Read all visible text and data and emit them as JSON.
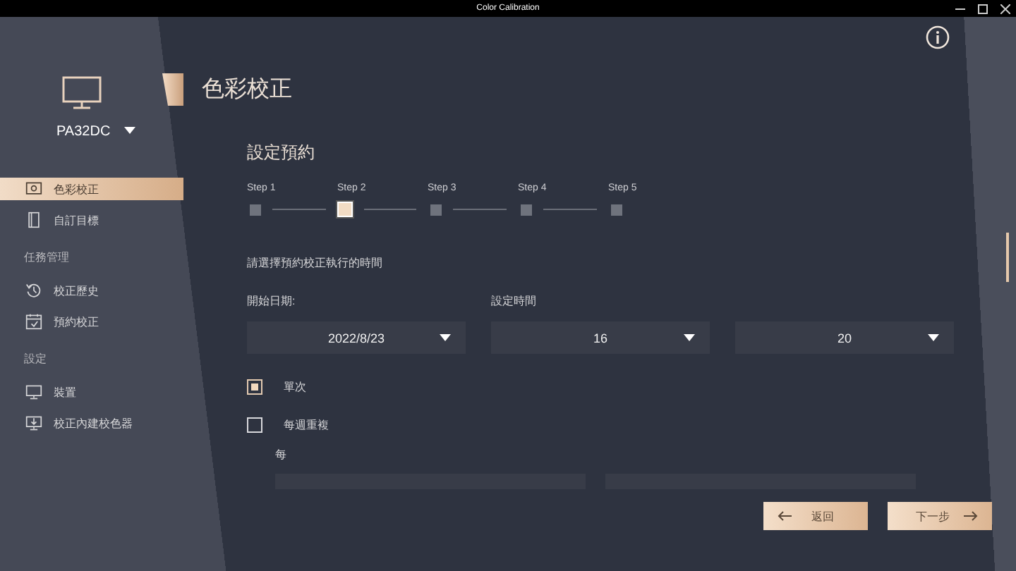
{
  "window": {
    "title": "Color Calibration"
  },
  "sidebar": {
    "device": "PA32DC",
    "sections": [
      {
        "items": [
          {
            "label": "色彩校正",
            "selected": true
          },
          {
            "label": "自訂目標",
            "selected": false
          }
        ]
      },
      {
        "heading": "任務管理",
        "items": [
          {
            "label": "校正歷史",
            "selected": false
          },
          {
            "label": "預約校正",
            "selected": false
          }
        ]
      },
      {
        "heading": "設定",
        "items": [
          {
            "label": "裝置",
            "selected": false
          },
          {
            "label": "校正內建校色器",
            "selected": false
          }
        ]
      }
    ]
  },
  "page": {
    "title": "色彩校正",
    "section_title": "設定預約",
    "steps": [
      {
        "label": "Step 1",
        "selected": false
      },
      {
        "label": "Step 2",
        "selected": true
      },
      {
        "label": "Step 3",
        "selected": false
      },
      {
        "label": "Step 4",
        "selected": false
      },
      {
        "label": "Step 5",
        "selected": false
      }
    ],
    "instruction": "請選擇預約校正執行的時間",
    "start_date": {
      "label": "開始日期:",
      "value": "2022/8/23"
    },
    "time": {
      "label": "設定時間",
      "hour": "16",
      "minute": "20"
    },
    "options": [
      {
        "label": "單次",
        "checked": true
      },
      {
        "label": "每週重複",
        "checked": false
      }
    ],
    "repeat_label": "每",
    "buttons": [
      {
        "label": "返回",
        "kind": "back"
      },
      {
        "label": "下一步",
        "kind": "next"
      }
    ]
  }
}
